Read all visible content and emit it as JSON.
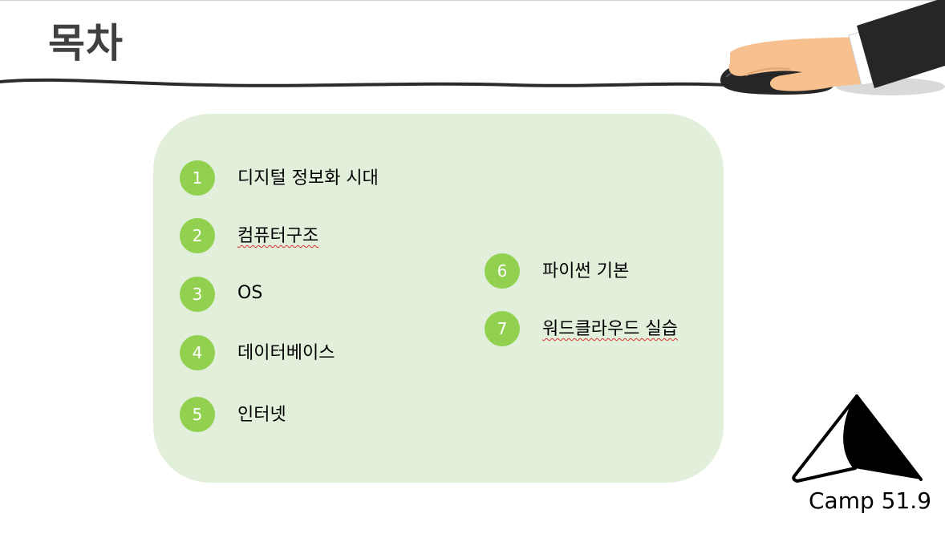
{
  "slide": {
    "title": "목차"
  },
  "toc": {
    "items": [
      {
        "number": "1",
        "label": "디지털 정보화 시대"
      },
      {
        "number": "2",
        "label": "컴퓨터구조"
      },
      {
        "number": "3",
        "label": "OS"
      },
      {
        "number": "4",
        "label": "데이터베이스"
      },
      {
        "number": "5",
        "label": "인터넷"
      },
      {
        "number": "6",
        "label": "파이썬 기본"
      },
      {
        "number": "7",
        "label": "워드클라우드 실습"
      }
    ]
  },
  "brand": {
    "name": "Camp 51.9"
  },
  "colors": {
    "panel": "#e2efda",
    "badge": "#92d050",
    "title": "#404040",
    "spellcheck_underline": "#e03030"
  },
  "icons": [
    "mouse-hand-illustration",
    "camp-tent-logo"
  ]
}
